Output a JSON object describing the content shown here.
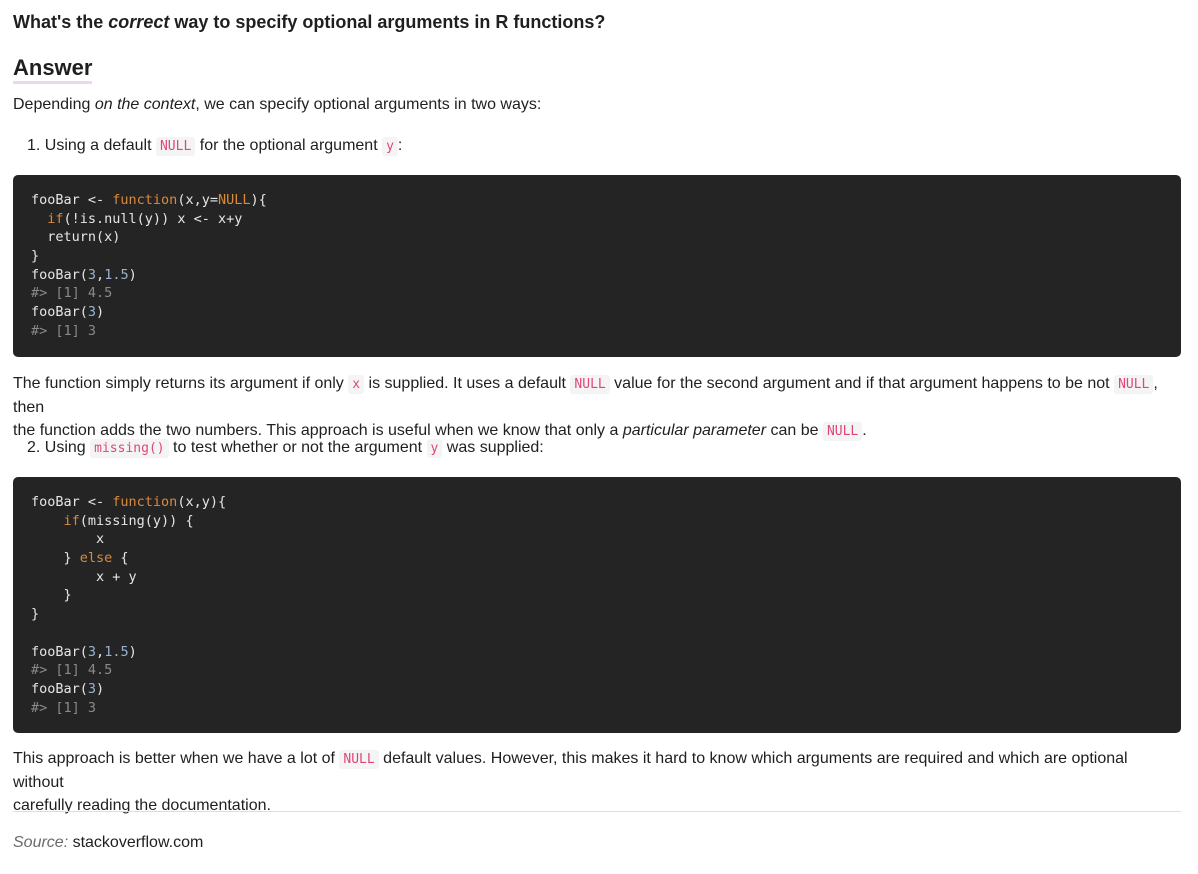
{
  "question": {
    "before": "What's the ",
    "em": "correct",
    "after": " way to specify optional arguments in R functions?"
  },
  "answer_heading": "Answer",
  "intro": {
    "before": "Depending ",
    "em": "on the context",
    "after": ", we can specify optional arguments in two ways:"
  },
  "item1": {
    "num": "1.",
    "t1": "Using a default ",
    "c1": "NULL",
    "t2": " for the optional argument ",
    "c2": "y",
    "t3": ":"
  },
  "code1": [
    [
      [
        "pl",
        "fooBar <- "
      ],
      [
        "kw",
        "function"
      ],
      [
        "pl",
        "(x,y="
      ],
      [
        "kw",
        "NULL"
      ],
      [
        "pl",
        "){"
      ]
    ],
    [
      [
        "pl",
        "  "
      ],
      [
        "kw",
        "if"
      ],
      [
        "pl",
        "(!is.null(y)) x <- x+y"
      ]
    ],
    [
      [
        "pl",
        "  return(x)"
      ]
    ],
    [
      [
        "pl",
        "}"
      ]
    ],
    [
      [
        "pl",
        "fooBar("
      ],
      [
        "num",
        "3"
      ],
      [
        "pl",
        ","
      ],
      [
        "num",
        "1.5"
      ],
      [
        "pl",
        ")"
      ]
    ],
    [
      [
        "cm",
        "#> [1] 4.5"
      ]
    ],
    [
      [
        "pl",
        "fooBar("
      ],
      [
        "num",
        "3"
      ],
      [
        "pl",
        ")"
      ]
    ],
    [
      [
        "cm",
        "#> [1] 3"
      ]
    ]
  ],
  "para2": {
    "t1": "The function simply returns its argument if only ",
    "c1": "x",
    "t2": " is supplied. It uses a default ",
    "c2": "NULL",
    "t3": " value for the second argument and if that argument happens to be not ",
    "c3": "NULL",
    "t4": ", then",
    "t5": "the function adds the two numbers. This approach is useful when we know that only a ",
    "em": "particular parameter",
    "t6": " can be ",
    "c4": "NULL",
    "t7": "."
  },
  "item2": {
    "num": "2.",
    "t1": "Using ",
    "c1": "missing()",
    "t2": " to test whether or not the argument ",
    "c2": "y",
    "t3": " was supplied:"
  },
  "code2": [
    [
      [
        "pl",
        "fooBar <- "
      ],
      [
        "kw",
        "function"
      ],
      [
        "pl",
        "(x,y){"
      ]
    ],
    [
      [
        "pl",
        "    "
      ],
      [
        "kw",
        "if"
      ],
      [
        "pl",
        "(missing(y)) {"
      ]
    ],
    [
      [
        "pl",
        "        x"
      ]
    ],
    [
      [
        "pl",
        "    } "
      ],
      [
        "kw",
        "else"
      ],
      [
        "pl",
        " {"
      ]
    ],
    [
      [
        "pl",
        "        x + y"
      ]
    ],
    [
      [
        "pl",
        "    }"
      ]
    ],
    [
      [
        "pl",
        "}"
      ]
    ],
    [
      [
        "pl",
        ""
      ]
    ],
    [
      [
        "pl",
        "fooBar("
      ],
      [
        "num",
        "3"
      ],
      [
        "pl",
        ","
      ],
      [
        "num",
        "1.5"
      ],
      [
        "pl",
        ")"
      ]
    ],
    [
      [
        "cm",
        "#> [1] 4.5"
      ]
    ],
    [
      [
        "pl",
        "fooBar("
      ],
      [
        "num",
        "3"
      ],
      [
        "pl",
        ")"
      ]
    ],
    [
      [
        "cm",
        "#> [1] 3"
      ]
    ]
  ],
  "para3": {
    "t1": "This approach is better when we have a lot of ",
    "c1": "NULL",
    "t2": " default values. However, this makes it hard to know which arguments are required and which are optional without",
    "t3": "carefully reading the documentation."
  },
  "source": {
    "label": "Source:",
    "value": " stackoverflow.com"
  }
}
